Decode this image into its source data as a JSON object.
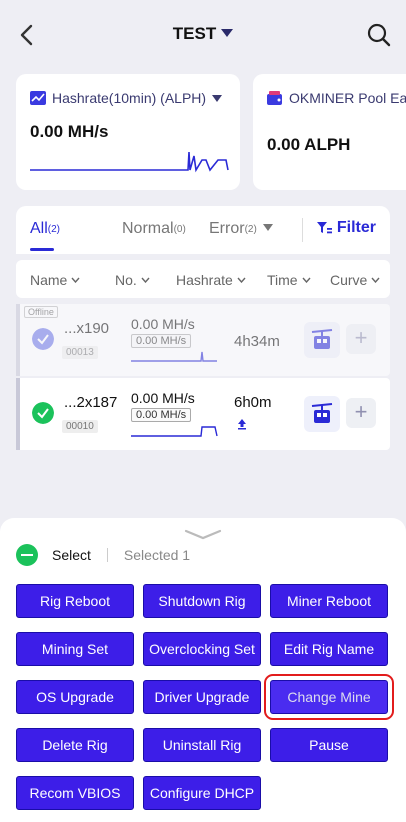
{
  "header": {
    "title": "TEST"
  },
  "cards": [
    {
      "title": "Hashrate(10min) (ALPH)",
      "value": "0.00 MH/s"
    },
    {
      "title": "OKMINER Pool Earn",
      "value": "0.00 ALPH"
    }
  ],
  "tabs": [
    {
      "label": "All",
      "count": "(2)"
    },
    {
      "label": "Normal",
      "count": "(0)"
    },
    {
      "label": "Error",
      "count": "(2)"
    }
  ],
  "filter_label": "Filter",
  "columns": [
    "Name",
    "No.",
    "Hashrate",
    "Time",
    "Curve"
  ],
  "rigs": [
    {
      "status": "Offline",
      "name": "...x190",
      "no": "00013",
      "hashrate": "0.00 MH/s",
      "hashrate_box": "0.00 MH/s",
      "time": "4h34m"
    },
    {
      "status": "",
      "name": "...2x187",
      "no": "00010",
      "hashrate": "0.00 MH/s",
      "hashrate_box": "0.00 MH/s",
      "time": "6h0m"
    }
  ],
  "sheet": {
    "select_label": "Select",
    "selected_label": "Selected 1",
    "buttons": [
      "Rig Reboot",
      "Shutdown Rig",
      "Miner Reboot",
      "Mining Set",
      "Overclocking Set",
      "Edit Rig Name",
      "OS Upgrade",
      "Driver Upgrade",
      "Change Mine",
      "Delete Rig",
      "Uninstall Rig",
      "Pause",
      "Recom VBIOS",
      "Configure DHCP"
    ]
  },
  "colors": {
    "accent": "#2a2ad6",
    "button": "#3d1ee8",
    "success": "#1bc25b",
    "highlight": "#e21c1c"
  }
}
